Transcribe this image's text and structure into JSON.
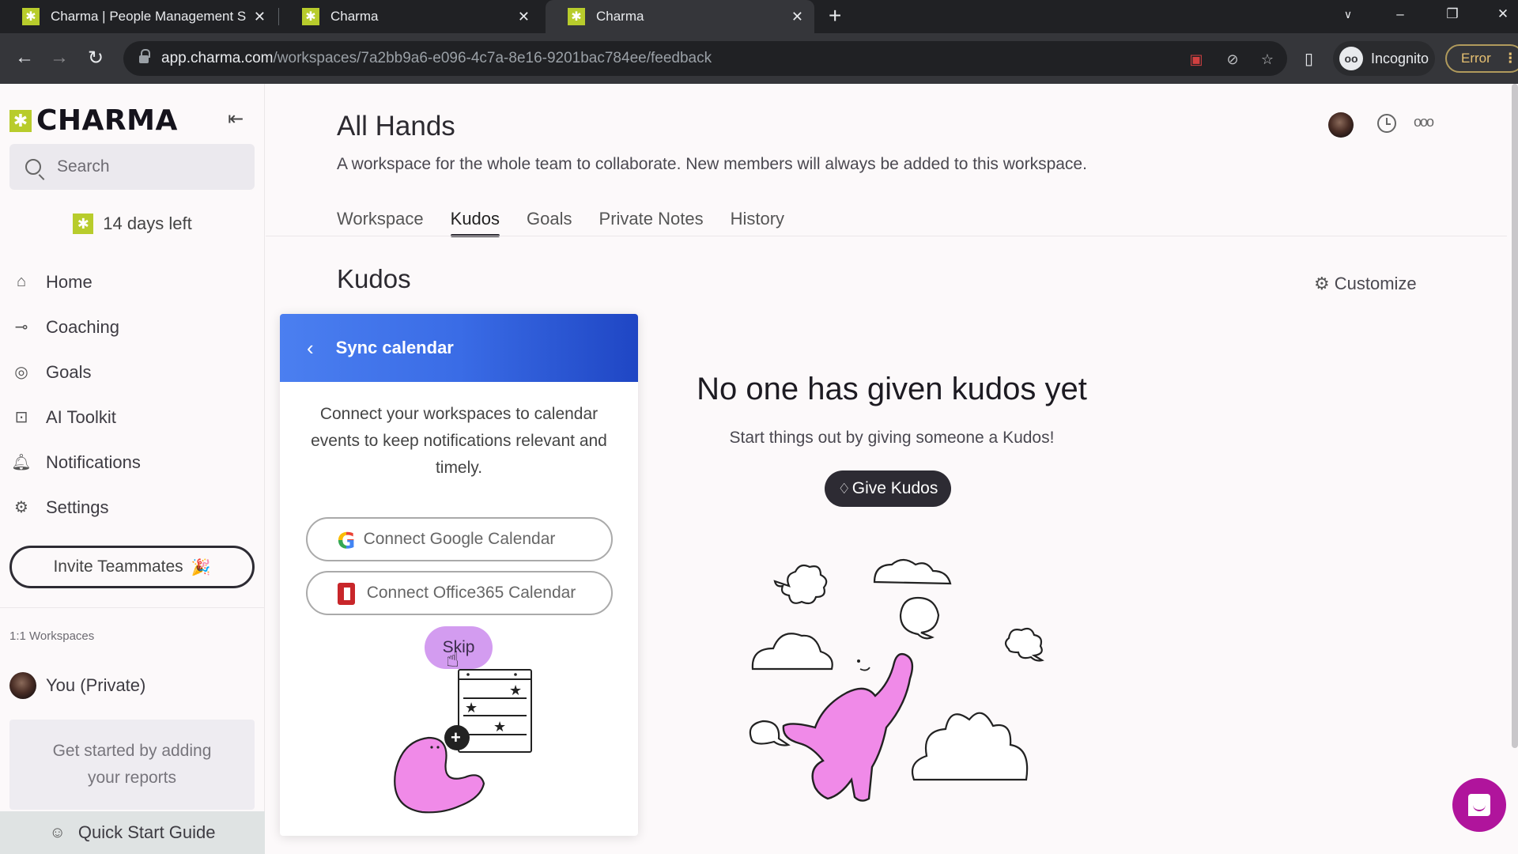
{
  "browser": {
    "tabs": [
      {
        "title": "Charma | People Management S",
        "active": false
      },
      {
        "title": "Charma",
        "active": false
      },
      {
        "title": "Charma",
        "active": true
      }
    ],
    "url_host": "app.charma.com",
    "url_path": "/workspaces/7a2bb9a6-e096-4c7a-8e16-9201bac784ee/feedback",
    "profile_label": "Incognito",
    "error_label": "Error"
  },
  "sidebar": {
    "brand": "CHARMA",
    "search_placeholder": "Search",
    "trial_text": "14 days left",
    "nav": [
      {
        "label": "Home",
        "icon": "home-icon"
      },
      {
        "label": "Coaching",
        "icon": "whistle-icon"
      },
      {
        "label": "Goals",
        "icon": "target-icon"
      },
      {
        "label": "AI Toolkit",
        "icon": "robot-icon"
      },
      {
        "label": "Notifications",
        "icon": "bell-icon"
      },
      {
        "label": "Settings",
        "icon": "gear-icon"
      }
    ],
    "invite_label": "Invite Teammates",
    "invite_emoji": "🎉",
    "workspaces_heading": "1:1 Workspaces",
    "private_workspace": "You (Private)",
    "reports_hint": "Get started by adding your reports",
    "quick_start": "Quick Start Guide"
  },
  "main": {
    "workspace_title": "All Hands",
    "workspace_description": "A workspace for the whole team to collaborate. New members will always be added to this workspace.",
    "tabs": [
      {
        "label": "Workspace",
        "active": false
      },
      {
        "label": "Kudos",
        "active": true
      },
      {
        "label": "Goals",
        "active": false
      },
      {
        "label": "Private Notes",
        "active": false
      },
      {
        "label": "History",
        "active": false
      }
    ],
    "section_title": "Kudos",
    "customize_label": "Customize",
    "empty_title": "No one has given kudos yet",
    "empty_subtitle": "Start things out by giving someone a Kudos!",
    "give_kudos_label": "Give Kudos"
  },
  "popup": {
    "title": "Sync calendar",
    "description": "Connect your workspaces to calendar events to keep notifications relevant and timely.",
    "google_label": "Connect Google Calendar",
    "office_label": "Connect Office365 Calendar",
    "skip_label": "Skip"
  },
  "colors": {
    "brand_green": "#b8cc2c",
    "popup_header_blue": "#3a6ce6",
    "skip_purple": "#d39cf0",
    "chat_magenta": "#b0149c",
    "mascot_pink": "#f08ae8"
  }
}
